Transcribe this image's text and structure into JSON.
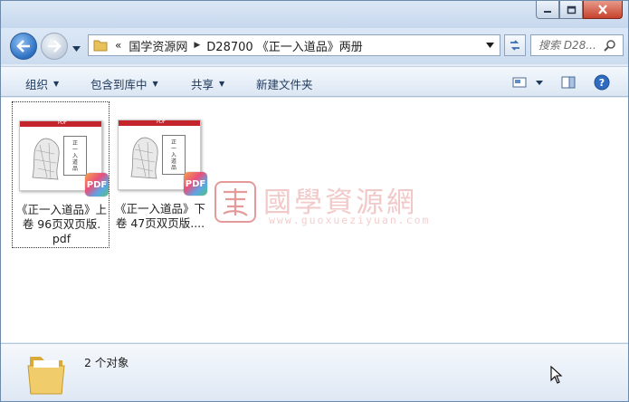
{
  "address": {
    "overflow": "«",
    "crumbs": [
      "国学资源网",
      "D28700 《正一入道品》两册"
    ]
  },
  "search": {
    "placeholder": "搜索 D28..."
  },
  "toolbar": {
    "organize": "组织",
    "include_library": "包含到库中",
    "share": "共享",
    "new_folder": "新建文件夹"
  },
  "files": [
    {
      "line1": "《正一入道品》上",
      "line2": "卷 96页双页版.",
      "line3": "pdf",
      "thumb_col": "正一入道品",
      "badge": "PDF",
      "selected": true
    },
    {
      "line1": "《正一入道品》下",
      "line2": "卷 47页双页版....",
      "line3": "",
      "thumb_col": "正一入道品",
      "badge": "PDF",
      "selected": false
    }
  ],
  "thumb_header": "PDF",
  "watermark": {
    "title": "國學資源網",
    "url": "www.guoxueziyuan.com",
    "seal": "国"
  },
  "details": {
    "count": "2 个对象"
  },
  "colors": {
    "accent": "#1e395b",
    "pdf_red": "#c4242b",
    "watermark": "#f1c9c9"
  },
  "icons": [
    "minimize-icon",
    "maximize-icon",
    "close-icon",
    "back-arrow-icon",
    "forward-arrow-icon",
    "folder-icon",
    "refresh-icon",
    "search-icon",
    "view-icon",
    "preview-pane-icon",
    "help-icon",
    "pdf-icon",
    "cursor-icon"
  ]
}
